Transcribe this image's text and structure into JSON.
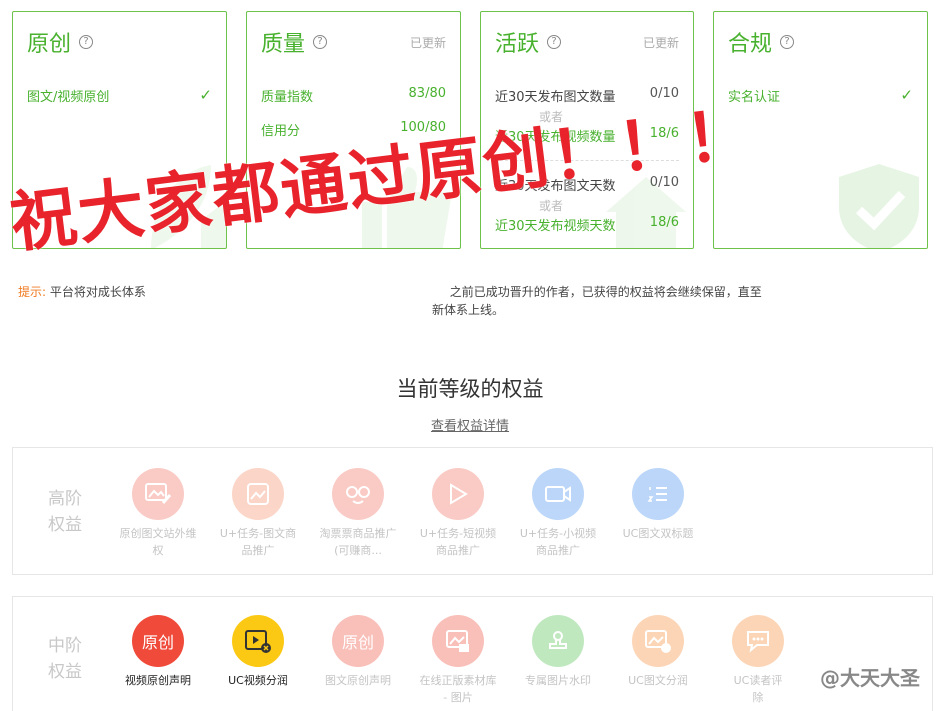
{
  "cards": {
    "original": {
      "title": "原创",
      "rows": [
        {
          "label": "图文/视频原创"
        }
      ]
    },
    "quality": {
      "title": "质量",
      "updated": "已更新",
      "rows": [
        {
          "label": "质量指数",
          "value": "83/80"
        },
        {
          "label": "信用分",
          "value": "100/80"
        }
      ]
    },
    "activity": {
      "title": "活跃",
      "updated": "已更新",
      "group1": {
        "a_label": "近30天发布图文数量",
        "a_value": "0/10",
        "or": "或者",
        "b_label": "近30天发布视频数量",
        "b_value": "18/6"
      },
      "group2": {
        "a_label": "近30天发布图文天数",
        "a_value": "0/10",
        "or": "或者",
        "b_label": "近30天发布视频天数",
        "b_value": "18/6"
      }
    },
    "compliance": {
      "title": "合规",
      "rows": [
        {
          "label": "实名认证"
        }
      ]
    }
  },
  "hint": {
    "label": "提示:",
    "text": "平台将对成长体系",
    "text_tail": "之前已成功晋升的作者，已获得的权益将会继续保留，直至",
    "line2": "新体系上线。"
  },
  "overlay_text": "祝大家都通过原创！！！",
  "section": {
    "title": "当前等级的权益",
    "link": "查看权益详情"
  },
  "high_rights": {
    "level": [
      "高阶",
      "权益"
    ],
    "items": [
      {
        "name": [
          "原创图文站外维",
          "权"
        ],
        "color": "#f26b5b",
        "icon": "image-edit-icon"
      },
      {
        "name": [
          "U+任务-图文商",
          "品推广"
        ],
        "color": "#f58a62",
        "icon": "image-icon"
      },
      {
        "name": [
          "淘票票商品推广",
          "(可赚商..."
        ],
        "color": "#f26b5b",
        "icon": "glasses-face-icon"
      },
      {
        "name": [
          "U+任务-短视频",
          "商品推广"
        ],
        "color": "#f26b5b",
        "icon": "play-icon"
      },
      {
        "name": [
          "U+任务-小视频",
          "商品推广"
        ],
        "color": "#3f8cf0",
        "icon": "video-camera-icon"
      },
      {
        "name": [
          "UC图文双标题",
          ""
        ],
        "color": "#3f8cf0",
        "icon": "list-icon"
      }
    ]
  },
  "mid_rights": {
    "level": [
      "中阶",
      "权益"
    ],
    "items": [
      {
        "name": [
          "视频原创声明",
          ""
        ],
        "color": "#f04a3a",
        "icon": "original-badge-icon",
        "badge": "原创",
        "active": true
      },
      {
        "name": [
          "UC视频分润",
          ""
        ],
        "color": "#fbc814",
        "icon": "video-share-icon",
        "active": true
      },
      {
        "name": [
          "图文原创声明",
          ""
        ],
        "color": "#f04a3a",
        "icon": "original-badge-icon",
        "badge": "原创"
      },
      {
        "name": [
          "在线正版素材库",
          "- 图片"
        ],
        "color": "#f04a3a",
        "icon": "image-library-icon"
      },
      {
        "name": [
          "专属图片水印",
          ""
        ],
        "color": "#4cbf4a",
        "icon": "stamp-icon"
      },
      {
        "name": [
          "UC图文分润",
          ""
        ],
        "color": "#f58a30",
        "icon": "image-share-icon"
      },
      {
        "name": [
          "UC读者评",
          "除"
        ],
        "color": "#f58a30",
        "icon": "comment-icon"
      }
    ]
  },
  "watermark": "@大天大圣"
}
